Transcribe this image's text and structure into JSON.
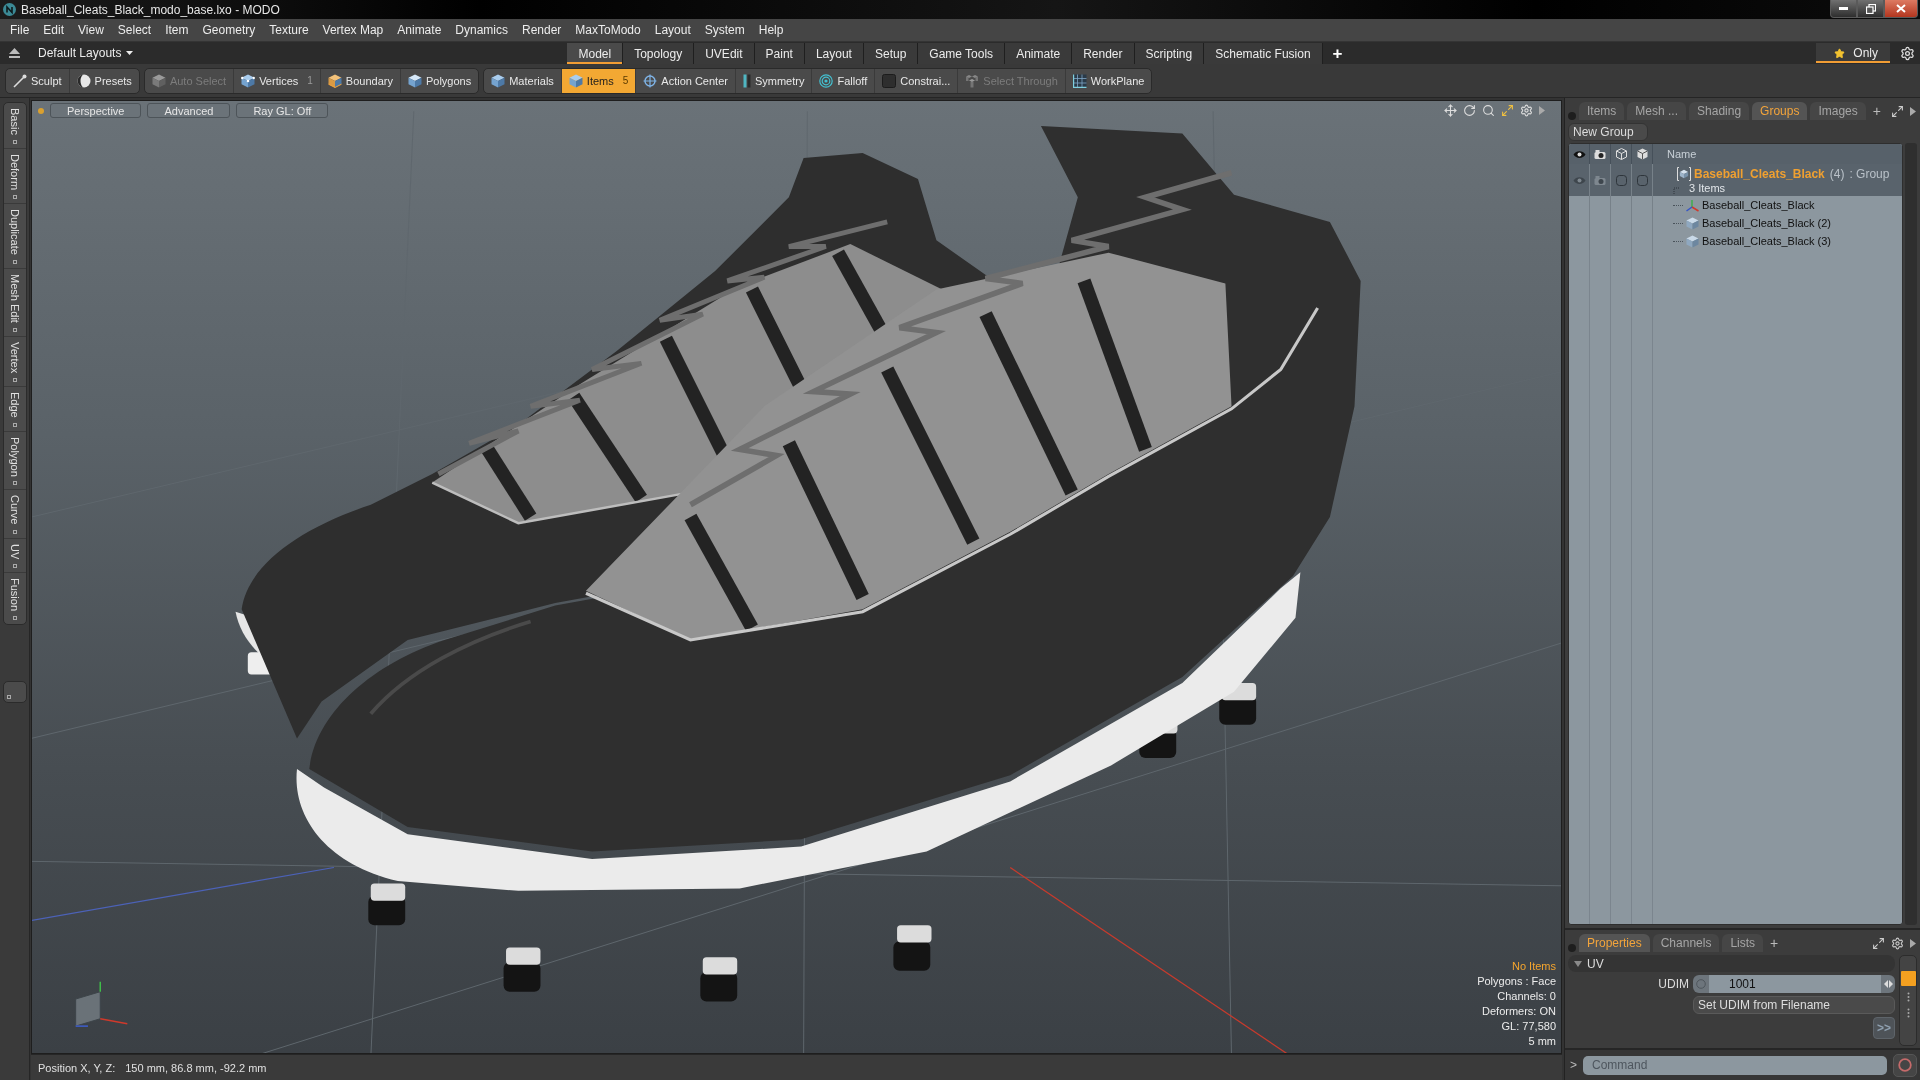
{
  "window": {
    "title": "Baseball_Cleats_Black_modo_base.lxo - MODO"
  },
  "menu": [
    "File",
    "Edit",
    "View",
    "Select",
    "Item",
    "Geometry",
    "Texture",
    "Vertex Map",
    "Animate",
    "Dynamics",
    "Render",
    "MaxToModo",
    "Layout",
    "System",
    "Help"
  ],
  "layout_bar": {
    "layouts": "Default Layouts",
    "tabs": [
      {
        "label": "Model",
        "selected": true
      },
      {
        "label": "Topology",
        "selected": false
      },
      {
        "label": "UVEdit",
        "selected": false
      },
      {
        "label": "Paint",
        "selected": false
      },
      {
        "label": "Layout",
        "selected": false
      },
      {
        "label": "Setup",
        "selected": false
      },
      {
        "label": "Game Tools",
        "selected": false
      },
      {
        "label": "Animate",
        "selected": false
      },
      {
        "label": "Render",
        "selected": false
      },
      {
        "label": "Scripting",
        "selected": false
      },
      {
        "label": "Schematic Fusion",
        "selected": false
      }
    ],
    "add_tab": "+",
    "only": "Only"
  },
  "toolbar": {
    "groups": [
      [
        {
          "kind": "brush",
          "label": "Sculpt",
          "selected": false,
          "disabled": false
        },
        {
          "kind": "sphere",
          "label": "Presets",
          "selected": false,
          "disabled": false
        }
      ],
      [
        {
          "kind": "cube",
          "label": "Auto Select",
          "selected": false,
          "disabled": true
        },
        {
          "kind": "vertex",
          "label": "Vertices",
          "count": "1",
          "selected": false,
          "disabled": false
        },
        {
          "kind": "edge",
          "label": "Boundary",
          "selected": false,
          "disabled": false
        },
        {
          "kind": "polygon",
          "label": "Polygons",
          "selected": false,
          "disabled": false
        }
      ],
      [
        {
          "kind": "material",
          "label": "Materials",
          "selected": false,
          "disabled": false
        },
        {
          "kind": "item",
          "label": "Items",
          "count": "5",
          "selected": true,
          "disabled": false
        },
        {
          "kind": "crosshair",
          "label": "Action Center",
          "selected": false,
          "disabled": false
        },
        {
          "kind": "symmetry",
          "label": "Symmetry",
          "selected": false,
          "disabled": false
        },
        {
          "kind": "falloff",
          "label": "Falloff",
          "selected": false,
          "disabled": false
        },
        {
          "kind": "constraint",
          "label": "Constrai...",
          "selected": false,
          "disabled": false
        },
        {
          "kind": "through",
          "label": "Select Through",
          "selected": false,
          "disabled": true
        },
        {
          "kind": "workplane",
          "label": "WorkPlane",
          "selected": false,
          "disabled": false
        }
      ]
    ]
  },
  "side_tabs": [
    "Basic",
    "Deform",
    "Duplicate",
    "Mesh Edit",
    "Vertex",
    "Edge",
    "Polygon",
    "Curve",
    "UV",
    "Fusion"
  ],
  "viewport": {
    "buttons": [
      "Perspective",
      "Advanced",
      "Ray GL: Off"
    ],
    "info_title": "No Items",
    "info": [
      "Polygons : Face",
      "Channels: 0",
      "Deformers: ON",
      "GL: 77,580",
      "5 mm"
    ]
  },
  "status_bar": {
    "label": "Position X, Y, Z:",
    "value": "150 mm, 86.8 mm, -92.2 mm"
  },
  "item_panel": {
    "tabs": [
      {
        "label": "Items",
        "selected": false
      },
      {
        "label": "Mesh ...",
        "selected": false
      },
      {
        "label": "Shading",
        "selected": false
      },
      {
        "label": "Groups",
        "selected": true
      },
      {
        "label": "Images",
        "selected": false
      }
    ],
    "add_tab": "+",
    "new_group": "New Group",
    "name_column": "Name",
    "groups": [
      {
        "name": "Baseball_Cleats_Black",
        "count": "(4)",
        "type": ": Group",
        "subtitle": "3 Items",
        "selected": true,
        "expanded": true,
        "children": [
          {
            "kind": "locator",
            "name": "Baseball_Cleats_Black",
            "selected": false
          },
          {
            "kind": "mesh",
            "name": "Baseball_Cleats_Black (2)",
            "selected": false
          },
          {
            "kind": "mesh",
            "name": "Baseball_Cleats_Black (3)",
            "selected": false
          }
        ]
      }
    ]
  },
  "properties_panel": {
    "tabs": [
      {
        "label": "Properties",
        "selected": true
      },
      {
        "label": "Channels",
        "selected": false
      },
      {
        "label": "Lists",
        "selected": false
      }
    ],
    "add_tab": "+",
    "section": {
      "title": "UV",
      "expanded": true
    },
    "udim": {
      "label": "UDIM",
      "value": "1001"
    },
    "set_button": "Set UDIM from Filename",
    "more_button": ">>"
  },
  "command": {
    "prompt": ">",
    "placeholder": "Command"
  }
}
